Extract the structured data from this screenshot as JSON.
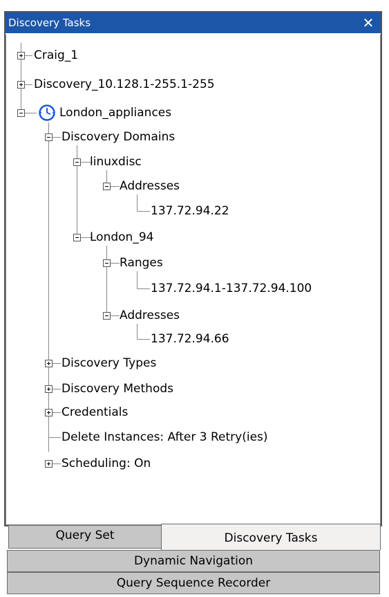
{
  "panel": {
    "title": "Discovery Tasks",
    "close_glyph": "✕"
  },
  "tree": {
    "craig": "Craig_1",
    "discovery_range": "Discovery_10.128.1-255.1-255",
    "london_appliances": "London_appliances",
    "discovery_domains": "Discovery Domains",
    "linuxdisc": "linuxdisc",
    "linuxdisc_addresses": "Addresses",
    "linuxdisc_ip": "137.72.94.22",
    "london_94": "London_94",
    "ranges": "Ranges",
    "range_value": "137.72.94.1-137.72.94.100",
    "london_addresses": "Addresses",
    "london_ip": "137.72.94.66",
    "discovery_types": "Discovery Types",
    "discovery_methods": "Discovery Methods",
    "credentials": "Credentials",
    "delete_instances": "Delete Instances: After 3 Retry(ies)",
    "scheduling": "Scheduling: On"
  },
  "tabs": {
    "query_set": "Query Set",
    "discovery_tasks": "Discovery Tasks",
    "dynamic_navigation": "Dynamic Navigation",
    "query_sequence_recorder": "Query Sequence Recorder"
  },
  "icons": {
    "task_icon": "clock-icon"
  },
  "colors": {
    "title_bar": "#1c56a8",
    "clock": "#1c56e0",
    "tree_lines": "#888888"
  }
}
